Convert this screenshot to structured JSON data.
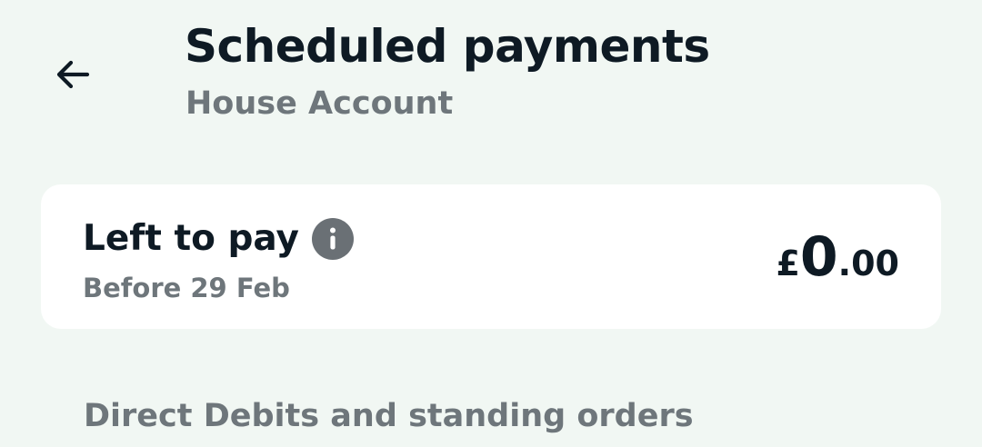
{
  "header": {
    "back_icon": "arrow-left-icon",
    "title": "Scheduled payments",
    "subtitle": "House Account"
  },
  "summary_card": {
    "title": "Left to pay",
    "info_icon": "info-icon",
    "subtitle": "Before 29 Feb",
    "amount": {
      "currency": "£",
      "major": "0",
      "minor": ".00"
    }
  },
  "section": {
    "title": "Direct Debits and standing orders"
  },
  "colors": {
    "background": "#f1f7f3",
    "card": "#ffffff",
    "text_primary": "#0e1a24",
    "text_secondary": "#6e767b",
    "info_icon_bg": "#6a7075"
  }
}
